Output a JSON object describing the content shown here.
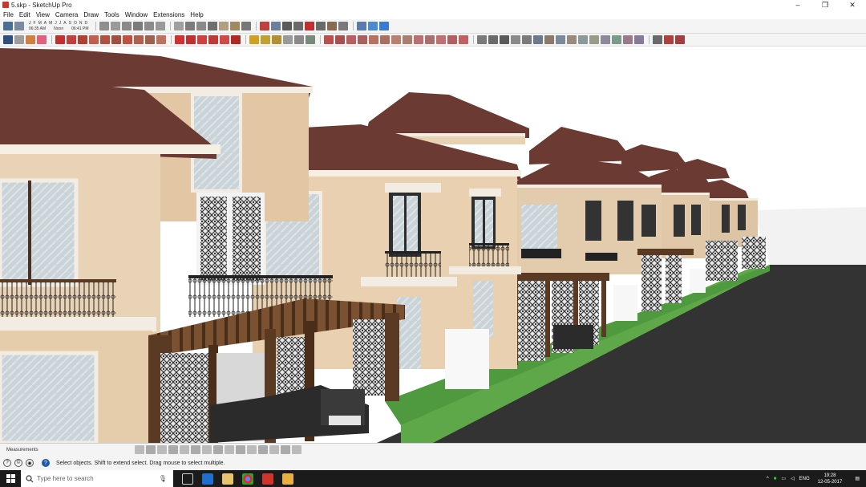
{
  "window": {
    "title": "5.skp - SketchUp Pro",
    "minimize": "–",
    "restore": "❐",
    "close": "✕"
  },
  "menu": [
    "File",
    "Edit",
    "View",
    "Camera",
    "Draw",
    "Tools",
    "Window",
    "Extensions",
    "Help"
  ],
  "shadows": {
    "months": [
      "J",
      "F",
      "M",
      "A",
      "M",
      "J",
      "J",
      "A",
      "S",
      "O",
      "N",
      "D"
    ],
    "time_start": "06:35 AM",
    "time_mid": "Noon",
    "time_end": "06:41 PM"
  },
  "measurements_label": "Measurements",
  "status_text": "Select objects. Shift to extend select. Drag mouse to select multiple.",
  "taskbar": {
    "search_placeholder": "Type here to search",
    "language": "ENG",
    "time": "19:28",
    "date": "12-05-2017"
  },
  "colors": {
    "sky": "#ffffff",
    "roof": "#6b3a33",
    "wall": "#e6cfb0",
    "road": "#323232",
    "grass": "#5fa84a",
    "wood": "#5a3a22"
  }
}
